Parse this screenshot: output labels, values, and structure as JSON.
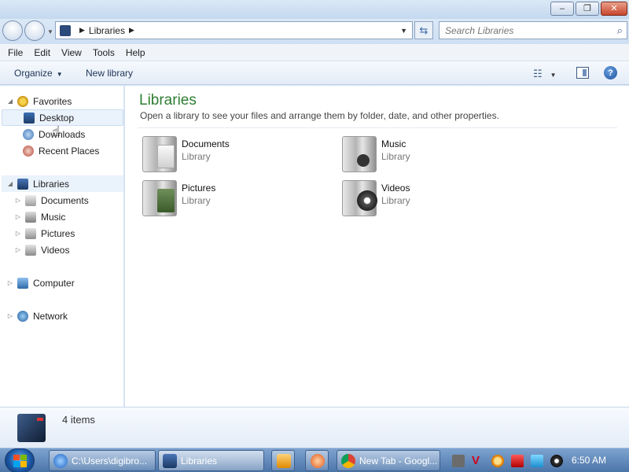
{
  "window": {
    "minimize_glyph": "–",
    "maximize_glyph": "❐",
    "close_glyph": "✕"
  },
  "address_bar": {
    "crumb": "Libraries",
    "separator_glyph": "▶",
    "dropdown_glyph": "▼"
  },
  "search": {
    "placeholder": "Search Libraries",
    "icon": "search-icon",
    "glyph": "⌕"
  },
  "menu": [
    "File",
    "Edit",
    "View",
    "Tools",
    "Help"
  ],
  "toolbar": {
    "organize_label": "Organize",
    "organize_arrow": "▼",
    "new_library_label": "New library",
    "views_glyph": "☷",
    "views_arrow": "▼",
    "help_glyph": "?"
  },
  "nav": {
    "favorites": {
      "label": "Favorites",
      "items": [
        "Desktop",
        "Downloads",
        "Recent Places"
      ]
    },
    "libraries": {
      "label": "Libraries",
      "items": [
        "Documents",
        "Music",
        "Pictures",
        "Videos"
      ]
    },
    "computer": "Computer",
    "network": "Network",
    "expanded_glyph": "◢",
    "collapsed_glyph": "▷",
    "cursor_glyph": "☝"
  },
  "content": {
    "title": "Libraries",
    "subtitle": "Open a library to see your files and arrange them by folder, date, and other properties.",
    "libraries": [
      {
        "name": "Documents",
        "type": "Library",
        "icon": "documents-library-icon"
      },
      {
        "name": "Music",
        "type": "Library",
        "icon": "music-library-icon"
      },
      {
        "name": "Pictures",
        "type": "Library",
        "icon": "pictures-library-icon"
      },
      {
        "name": "Videos",
        "type": "Library",
        "icon": "videos-library-icon"
      }
    ]
  },
  "details": {
    "count": "4 items"
  },
  "taskbar": {
    "tasks": [
      {
        "label": "C:\\Users\\digibro...",
        "icon": "ie-icon"
      },
      {
        "label": "Libraries",
        "icon": "libraries-icon"
      },
      {
        "label": "",
        "icon": "media-player-icon"
      },
      {
        "label": "",
        "icon": "pinned-app-icon"
      },
      {
        "label": "New Tab - Googl...",
        "icon": "chrome-icon"
      }
    ],
    "tray_icons": [
      "tray-app-icon",
      "tray-v-icon",
      "tray-search-icon",
      "tray-flag-icon",
      "tray-display-icon",
      "tray-volume-icon"
    ],
    "clock": "6:50 AM"
  },
  "colors": {
    "title_green": "#2e7d32",
    "frame_blue": "#cfe0f3",
    "taskbar_blue": "#4c75a8"
  }
}
